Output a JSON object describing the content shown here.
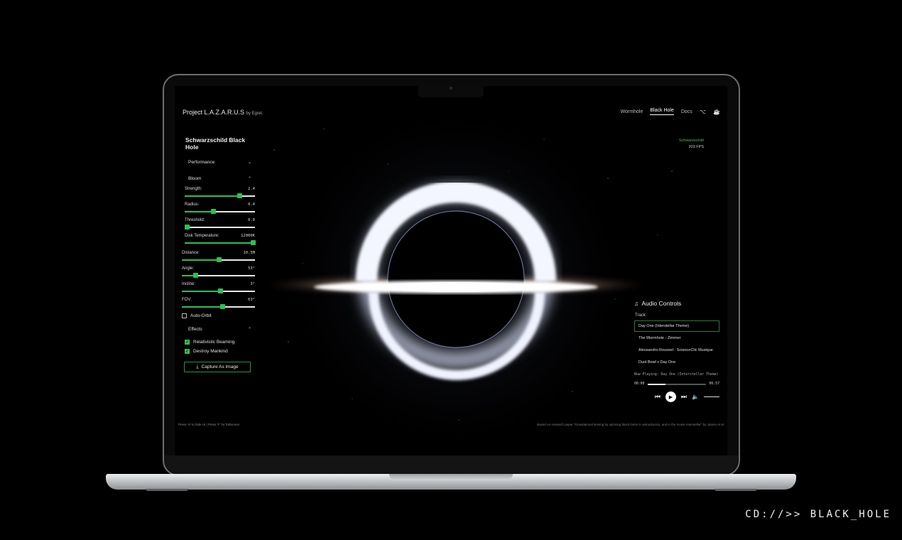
{
  "app": {
    "brand": "Project L.A.Z.A.R.U.S",
    "brand_suffix": "by Egret."
  },
  "nav": {
    "items": [
      "Wormhole",
      "Black Hole",
      "Docs"
    ],
    "active": "Black Hole",
    "icons": [
      "github-icon",
      "coffee-icon"
    ]
  },
  "stats": {
    "mode": "Schwarzschild",
    "fps": "203 FPS"
  },
  "panel": {
    "title": "Schwarzschild Black Hole",
    "sections": {
      "performance": "Performance",
      "bloom": "Bloom",
      "effects": "Effects"
    },
    "bloom_controls": [
      {
        "label": "Strength:",
        "value": "2.4",
        "fraction": 0.78
      },
      {
        "label": "Radius:",
        "value": "0.4",
        "fraction": 0.4
      },
      {
        "label": "Threshold:",
        "value": "0.0",
        "fraction": 0.03
      },
      {
        "label": "Disk Temperature:",
        "value": "12000K",
        "fraction": 0.97
      }
    ],
    "camera_controls": [
      {
        "label": "Distance:",
        "value": "10.5M",
        "fraction": 0.5
      },
      {
        "label": "Angle:",
        "value": "53°",
        "fraction": 0.18
      },
      {
        "label": "Incline:",
        "value": "3°",
        "fraction": 0.52
      },
      {
        "label": "FOV:",
        "value": "63°",
        "fraction": 0.55
      }
    ],
    "auto_orbit": {
      "label": "Auto-Orbit",
      "checked": false
    },
    "effects": [
      {
        "label": "Relativistic Beaming",
        "checked": true
      },
      {
        "label": "Destroy Mankind",
        "checked": true
      }
    ],
    "capture_label": "Capture As Image"
  },
  "audio": {
    "title": "Audio Controls",
    "track_label": "Track:",
    "tracks": [
      "Day One (Interstellar Theme)",
      "The Wormhole - Zimmer",
      "Alessandro Roussel - ScienceClic Musique",
      "Dust Bowl x Day One"
    ],
    "selected": 0,
    "now_playing": "Now Playing: Day One (Interstellar Theme)",
    "time_current": "00:00",
    "time_total": "06:57",
    "progress": 0.3
  },
  "footer": {
    "hint": "Press 'H' to hide UI | Press 'F' for fullscreen",
    "credit": "Based on research paper \"Gravitational lensing by spinning black holes in astrophysics, and in the movie Interstellar\" by James et al."
  },
  "caption": "CD://>> BLACK_HOLE",
  "colors": {
    "accent": "#2fbf55",
    "background": "#000000"
  }
}
